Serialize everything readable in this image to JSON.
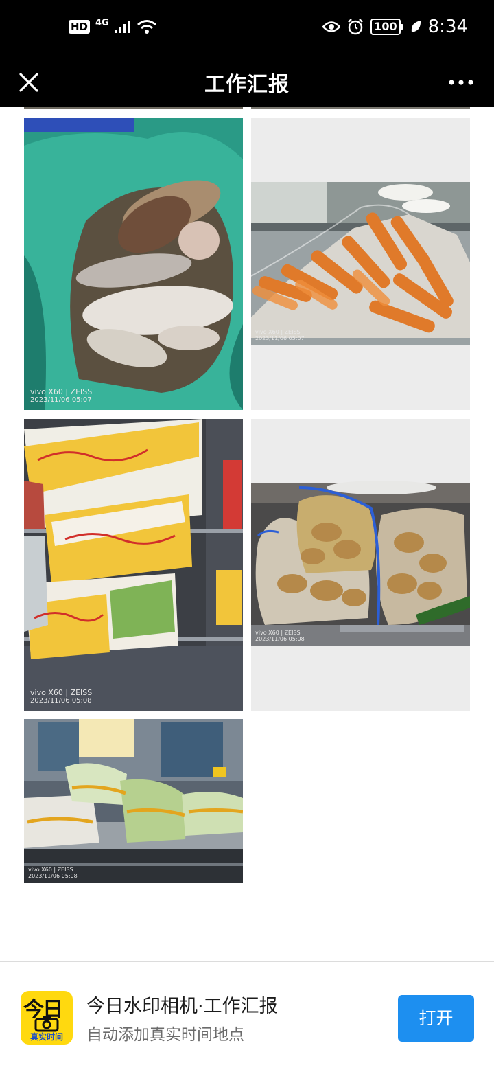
{
  "status_bar": {
    "hd": "HD",
    "network": "4G",
    "battery": "100",
    "time": "8:34",
    "icons": [
      "signal-icon",
      "wifi-icon",
      "eye-icon",
      "alarm-icon",
      "battery-icon",
      "leaf-icon"
    ]
  },
  "nav": {
    "title": "工作汇报",
    "close_icon": "close-icon",
    "more_icon": "more-icon"
  },
  "photos": [
    {
      "camera": "vivo X60 | ZEISS",
      "timestamp": "2023/11/06 05:07"
    },
    {
      "camera": "vivo X60 | ZEISS",
      "timestamp": "2023/11/06 05:07"
    },
    {
      "camera": "vivo X60 | ZEISS",
      "timestamp": "2023/11/06 05:08"
    },
    {
      "camera": "vivo X60 | ZEISS",
      "timestamp": "2023/11/06 05:08"
    },
    {
      "camera": "vivo X60 | ZEISS",
      "timestamp": "2023/11/06 05:08"
    }
  ],
  "app_banner": {
    "icon_text_top": "今日",
    "icon_text_bottom": "真实时间",
    "title": "今日水印相机·工作汇报",
    "subtitle": "自动添加真实时间地点",
    "open_label": "打开"
  },
  "colors": {
    "accent": "#1d8ff0",
    "app_icon_bg": "#ffd90f",
    "bar_bg": "#000000"
  }
}
